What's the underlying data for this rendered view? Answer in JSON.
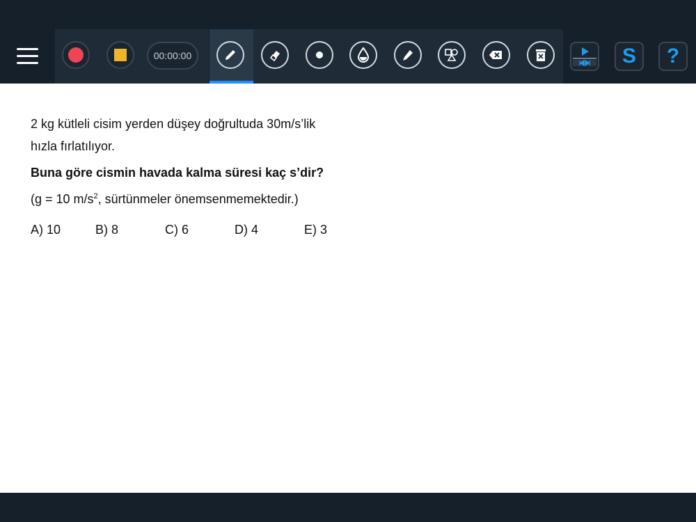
{
  "toolbar": {
    "timer_value": "00:00:00",
    "help_label": "?",
    "s_label": "S",
    "active_tool": "pen",
    "accent_color": "#1e90ff",
    "record_color": "#ef4456",
    "stop_color": "#f0b429",
    "icons": [
      "menu-icon",
      "record-icon",
      "stop-icon",
      "pen-icon",
      "eraser-icon",
      "dot-icon",
      "ink-drop-icon",
      "highlighter-icon",
      "shapes-icon",
      "backspace-icon",
      "trash-icon",
      "playback-icon",
      "s-icon",
      "help-icon"
    ]
  },
  "question": {
    "line1": "2 kg kütleli cisim yerden düşey doğrultuda 30m/s’lik",
    "line2": "hızla fırlatılıyor.",
    "bold_line": "Buna göre cismin havada kalma süresi kaç s’dir?",
    "note_prefix": "(g = 10 m/s",
    "note_sup": "2",
    "note_suffix": ", sürtünmeler önemsenmemektedir.)",
    "choices": [
      "A) 10",
      "B) 8",
      "C) 6",
      "D) 4",
      "E) 3"
    ]
  }
}
